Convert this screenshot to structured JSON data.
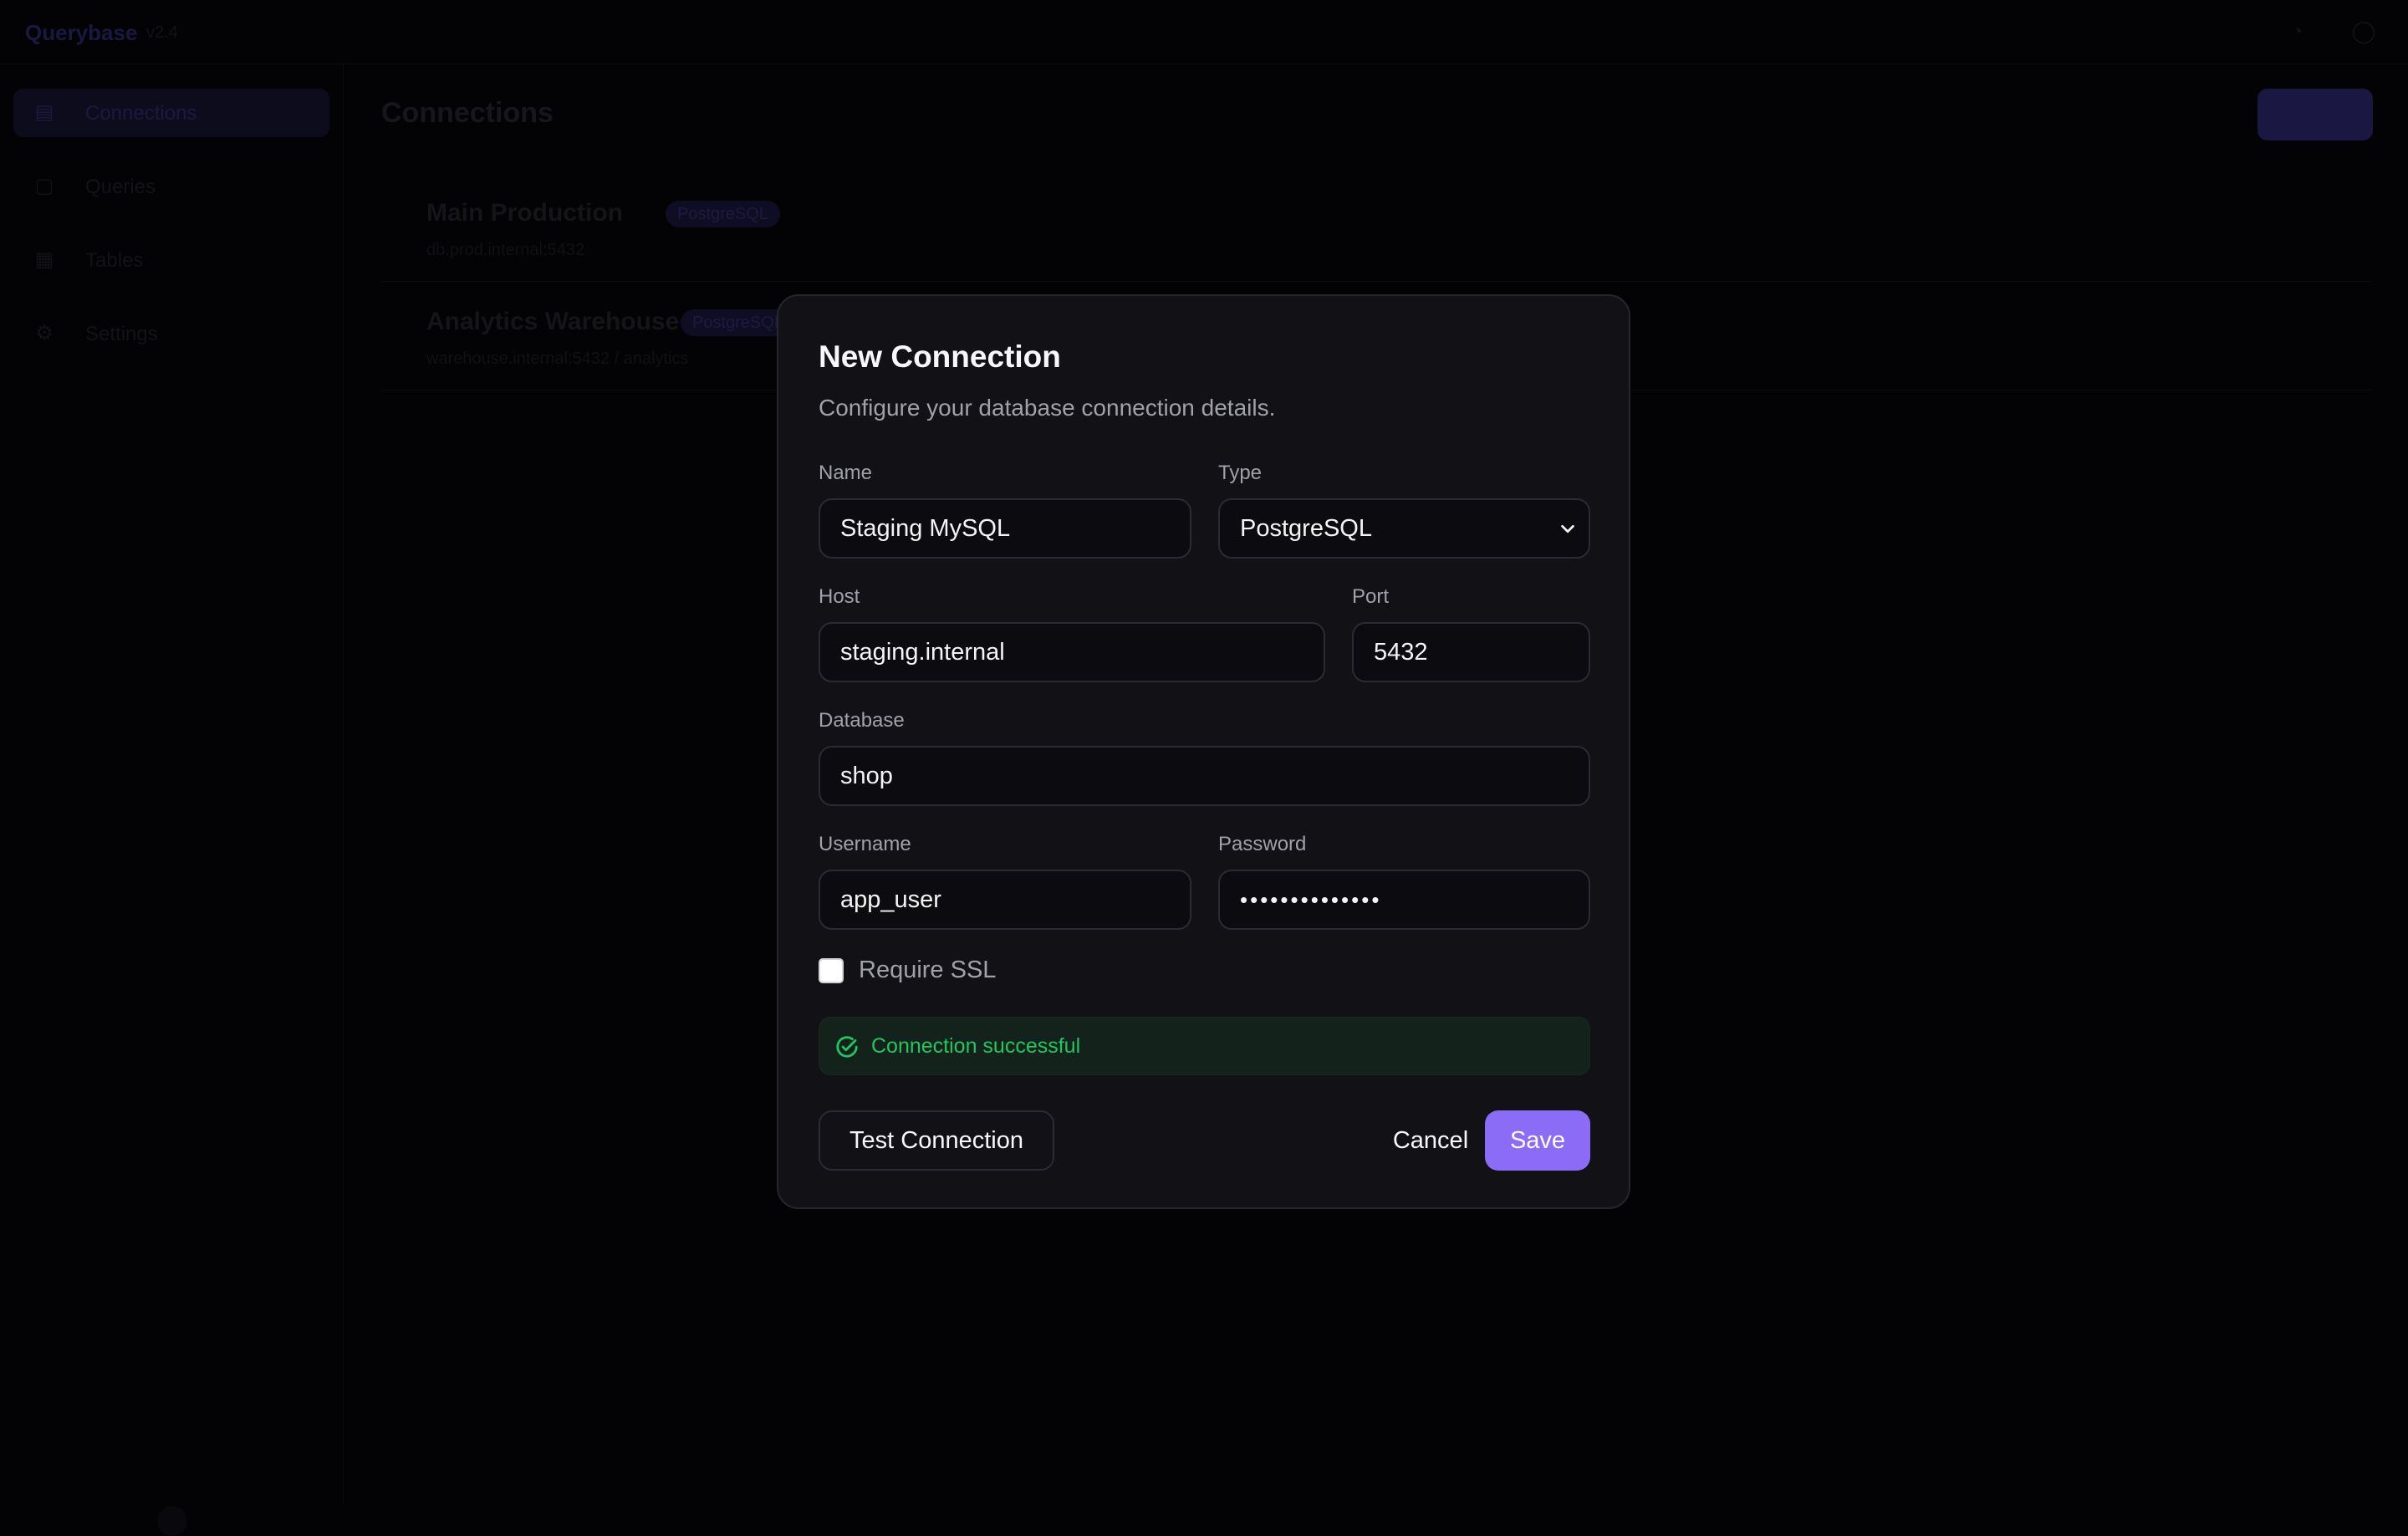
{
  "background": {
    "brand": "Querybase",
    "brand_sub": "v2.4",
    "sidebar_items": [
      {
        "label": "Connections",
        "icon": "database-icon"
      },
      {
        "label": "Queries",
        "icon": "terminal-icon"
      },
      {
        "label": "Tables",
        "icon": "table-icon"
      },
      {
        "label": "Settings",
        "icon": "gear-icon"
      }
    ],
    "main_title": "Connections",
    "primary_button": "",
    "connections": [
      {
        "name": "Main Production",
        "badge": "PostgreSQL",
        "meta": "db.prod.internal:5432"
      },
      {
        "name": "Analytics Warehouse",
        "badge": "PostgreSQL",
        "meta": "warehouse.internal:5432 / analytics"
      }
    ]
  },
  "modal": {
    "title": "New Connection",
    "description": "Configure your database connection details.",
    "fields": {
      "name": {
        "label": "Name",
        "value": "Staging MySQL"
      },
      "type": {
        "label": "Type",
        "value": "PostgreSQL",
        "options": [
          "PostgreSQL"
        ]
      },
      "host": {
        "label": "Host",
        "value": "staging.internal"
      },
      "port": {
        "label": "Port",
        "value": "5432"
      },
      "database": {
        "label": "Database",
        "value": "shop"
      },
      "username": {
        "label": "Username",
        "value": "app_user"
      },
      "password": {
        "label": "Password",
        "value": "••••••••••••••"
      }
    },
    "ssl": {
      "label": "Require SSL",
      "checked": false
    },
    "status": {
      "text": "Connection successful",
      "icon": "check-circle-icon",
      "color": "#22c55e"
    },
    "buttons": {
      "test": "Test Connection",
      "cancel": "Cancel",
      "save": "Save"
    },
    "colors": {
      "accent": "#8b6cf6",
      "surface": "#111116",
      "border": "#2b2b33"
    }
  }
}
